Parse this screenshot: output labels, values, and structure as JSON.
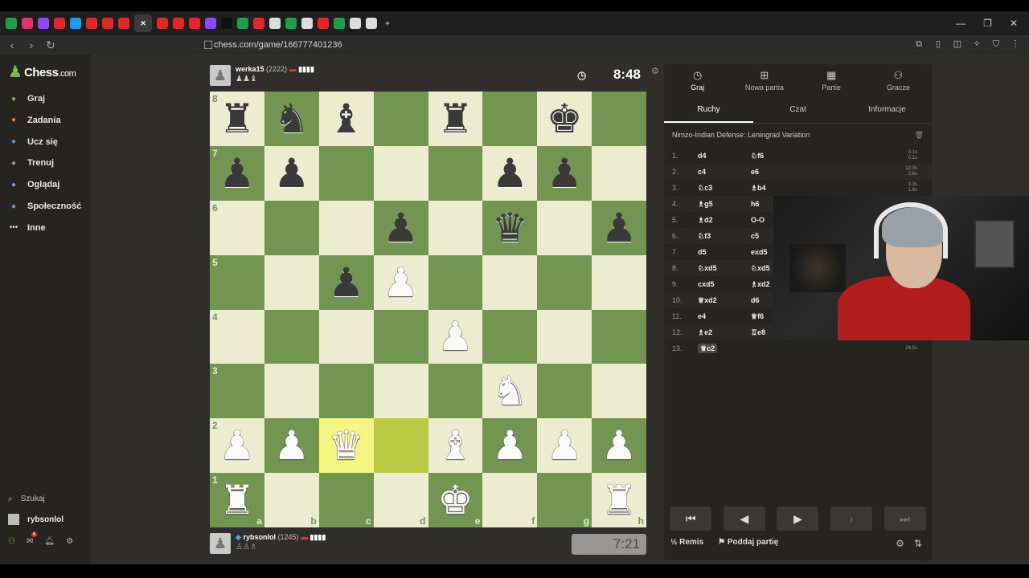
{
  "browser": {
    "url": "chess.com/game/166777401236"
  },
  "sidebar": {
    "logo_text": "Chess",
    "logo_suffix": ".com",
    "items": [
      {
        "label": "Graj",
        "icon": "play-hand-icon",
        "color": "#81b64c"
      },
      {
        "label": "Zadania",
        "icon": "puzzle-icon",
        "color": "#e8733a"
      },
      {
        "label": "Ucz się",
        "icon": "learn-icon",
        "color": "#2ea8d8"
      },
      {
        "label": "Trenuj",
        "icon": "train-icon",
        "color": "#999999"
      },
      {
        "label": "Oglądaj",
        "icon": "watch-icon",
        "color": "#6c9ad8"
      },
      {
        "label": "Społeczność",
        "icon": "community-icon",
        "color": "#5c9ad8"
      },
      {
        "label": "Inne",
        "icon": "more-icon",
        "color": "#cccccc"
      }
    ],
    "search_label": "Szukaj",
    "user_label": "rybsonlol",
    "notif_badge": "6"
  },
  "game": {
    "top_player": {
      "name": "werka15",
      "rating": "(2222)",
      "captured": "♟♟♝"
    },
    "bottom_player": {
      "name": "rybsonlol",
      "rating": "(1245)",
      "captured": "♙♙♗"
    },
    "top_clock": "8:48",
    "bottom_clock": "7:21",
    "board": [
      [
        "r",
        "n",
        "b",
        "",
        "r",
        "",
        "k",
        ""
      ],
      [
        "p",
        "p",
        "",
        "",
        "",
        "p",
        "p",
        ""
      ],
      [
        "",
        "",
        "",
        "p",
        "",
        "q",
        "",
        "p"
      ],
      [
        "",
        "",
        "p",
        "P",
        "",
        "",
        "",
        ""
      ],
      [
        "",
        "",
        "",
        "",
        "P",
        "",
        "",
        ""
      ],
      [
        "",
        "",
        "",
        "",
        "",
        "N",
        "",
        ""
      ],
      [
        "P",
        "P",
        "Q",
        "",
        "B",
        "P",
        "P",
        "P"
      ],
      [
        "R",
        "",
        "",
        "",
        "K",
        "",
        "",
        "R"
      ]
    ],
    "highlight": [
      "c2",
      "d2"
    ],
    "ranks": [
      "8",
      "7",
      "6",
      "5",
      "4",
      "3",
      "2",
      "1"
    ],
    "files": [
      "a",
      "b",
      "c",
      "d",
      "e",
      "f",
      "g",
      "h"
    ]
  },
  "panel": {
    "tabs": [
      {
        "label": "Graj",
        "icon": "stopwatch-icon"
      },
      {
        "label": "Nowa partia",
        "icon": "plus-icon"
      },
      {
        "label": "Partie",
        "icon": "board-icon"
      },
      {
        "label": "Gracze",
        "icon": "players-icon"
      }
    ],
    "subtabs": [
      "Ruchy",
      "Czat",
      "Informacje"
    ],
    "opening": "Nimzo-Indian Defense: Leningrad Variation",
    "moves": [
      {
        "n": "1.",
        "w": "d4",
        "b": "♘f6",
        "t": [
          "0.1s",
          "0.1s"
        ]
      },
      {
        "n": "2.",
        "w": "c4",
        "b": "e6",
        "t": [
          "12.0s",
          "2.6s"
        ]
      },
      {
        "n": "3.",
        "w": "♘c3",
        "b": "♗b4",
        "t": [
          "3.3s",
          "1.9s"
        ]
      },
      {
        "n": "4.",
        "w": "♗g5",
        "b": "h6",
        "t": []
      },
      {
        "n": "5.",
        "w": "♗d2",
        "b": "O-O",
        "t": []
      },
      {
        "n": "6.",
        "w": "♘f3",
        "b": "c5",
        "t": []
      },
      {
        "n": "7.",
        "w": "d5",
        "b": "exd5",
        "t": []
      },
      {
        "n": "8.",
        "w": "♘xd5",
        "b": "♘xd5",
        "t": []
      },
      {
        "n": "9.",
        "w": "cxd5",
        "b": "♗xd2",
        "t": []
      },
      {
        "n": "10.",
        "w": "♕xd2",
        "b": "d6",
        "t": []
      },
      {
        "n": "11.",
        "w": "e4",
        "b": "♕f6",
        "t": []
      },
      {
        "n": "12.",
        "w": "♗e2",
        "b": "♖e8",
        "t": []
      },
      {
        "n": "13.",
        "w": "♕c2",
        "b": "",
        "t": [
          "24.5s"
        ]
      }
    ],
    "draw_label": "Remis",
    "draw_prefix": "½",
    "resign_label": "Poddaj partię"
  }
}
